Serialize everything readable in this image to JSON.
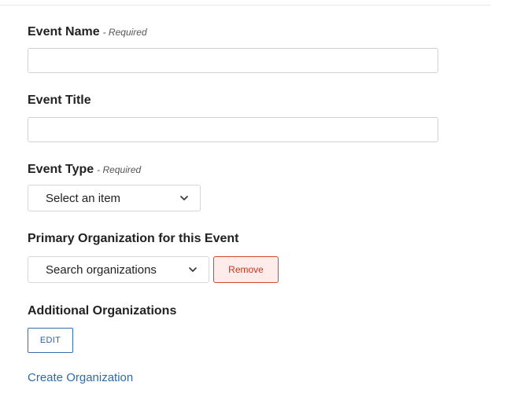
{
  "form": {
    "event_name": {
      "label": "Event Name",
      "required_note": "- Required",
      "value": ""
    },
    "event_title": {
      "label": "Event Title",
      "value": ""
    },
    "event_type": {
      "label": "Event Type",
      "required_note": "- Required",
      "selected": "Select an item"
    },
    "primary_org": {
      "label": "Primary Organization for this Event",
      "selected": "Search organizations",
      "remove_label": "Remove"
    },
    "additional_orgs": {
      "label": "Additional Organizations",
      "edit_label": "EDIT"
    },
    "create_org_link": "Create Organization"
  },
  "icons": {
    "dropdown": "chevron-down-icon"
  },
  "colors": {
    "link": "#2e6ba8",
    "remove_border": "#d6452f",
    "remove_bg": "#fdecea",
    "edit_border": "#3b6da8"
  }
}
